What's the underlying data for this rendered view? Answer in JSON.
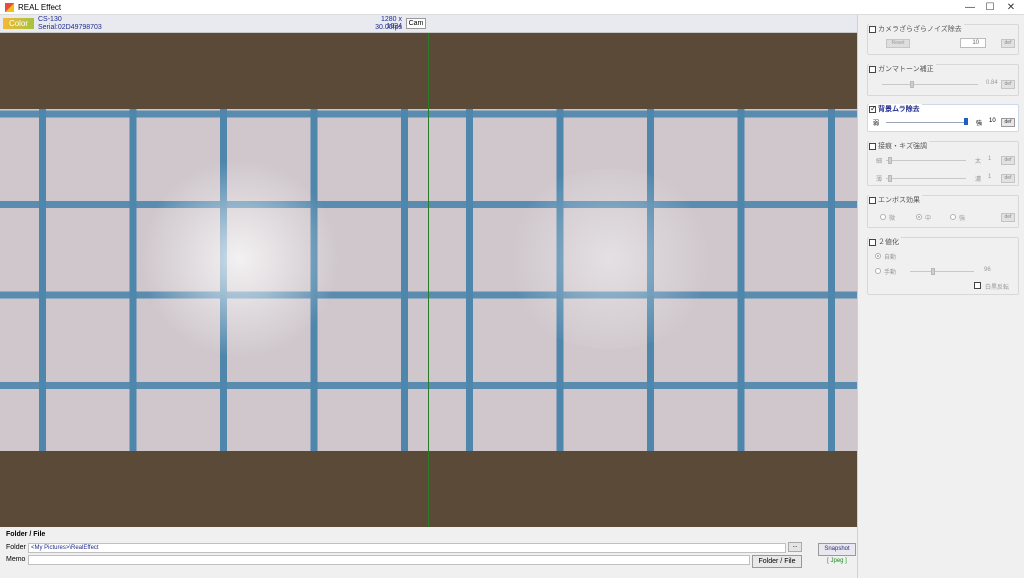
{
  "window": {
    "title": "REAL Effect",
    "buttons": {
      "minimize": "—",
      "maximize": "☐",
      "close": "✕"
    }
  },
  "camera": {
    "color_badge": "Color",
    "model": "CS-130",
    "serial": "Serial:02D49798703",
    "resolution": "1280 x 1024",
    "fps": "30.00fps",
    "cam_button": "Cam"
  },
  "bottom": {
    "folder_title": "Folder / File",
    "folder_label": "Folder",
    "folder_path": "<My Pictures>\\RealEffect",
    "memo_label": "Memo",
    "memo_value": "",
    "browse_label": "...",
    "folder_file_button": "Folder / File",
    "snapshot_button": "Snapshot",
    "format_label": "[ Jpeg ]"
  },
  "effects": {
    "noise": {
      "title": "カメラざらざらノイズ除去",
      "enabled": false,
      "reset_label": "Reset",
      "value": "10",
      "def_label": "def"
    },
    "gamma": {
      "title": "ガンマトーン補正",
      "enabled": false,
      "value": "0.84",
      "level": 0.3,
      "def_label": "def"
    },
    "background": {
      "title": "背景ムラ除去",
      "enabled": true,
      "weak_label": "弱",
      "strong_label": "強",
      "value": "10",
      "level": 1.0,
      "def_label": "def"
    },
    "scratch": {
      "title": "接痕・キズ強調",
      "enabled": false,
      "row1_left": "細",
      "row1_right": "太",
      "row1_value": "1",
      "row2_left": "薄",
      "row2_right": "濃",
      "row2_value": "1",
      "def_label": "def"
    },
    "emboss": {
      "title": "エンボス効果",
      "enabled": false,
      "options": [
        "微",
        "中",
        "強"
      ],
      "selected": "中",
      "def_label": "def"
    },
    "binarize": {
      "title": "２値化",
      "enabled": false,
      "auto_label": "自動",
      "manual_label": "手動",
      "value": "96",
      "level": 0.35,
      "invert_label": "白黒反転"
    }
  }
}
